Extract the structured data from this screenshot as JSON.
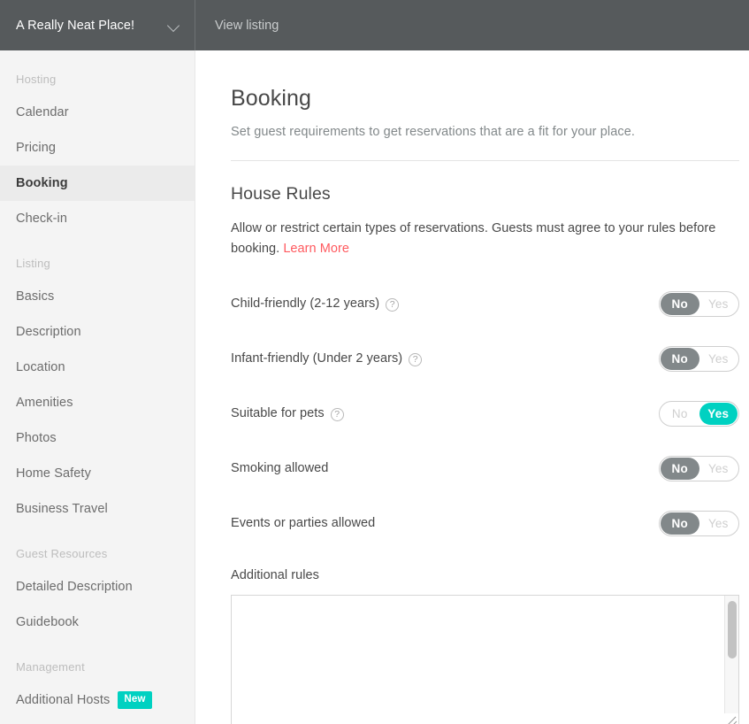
{
  "topbar": {
    "listing_name": "A Really Neat Place!",
    "dropdown_icon": "chevron-down-icon",
    "view_listing_label": "View listing"
  },
  "sidebar": {
    "groups": [
      {
        "title": "Hosting",
        "items": [
          {
            "label": "Calendar",
            "active": false
          },
          {
            "label": "Pricing",
            "active": false
          },
          {
            "label": "Booking",
            "active": true
          },
          {
            "label": "Check-in",
            "active": false
          }
        ]
      },
      {
        "title": "Listing",
        "items": [
          {
            "label": "Basics",
            "active": false
          },
          {
            "label": "Description",
            "active": false
          },
          {
            "label": "Location",
            "active": false
          },
          {
            "label": "Amenities",
            "active": false
          },
          {
            "label": "Photos",
            "active": false
          },
          {
            "label": "Home Safety",
            "active": false
          },
          {
            "label": "Business Travel",
            "active": false
          }
        ]
      },
      {
        "title": "Guest Resources",
        "items": [
          {
            "label": "Detailed Description",
            "active": false
          },
          {
            "label": "Guidebook",
            "active": false
          }
        ]
      },
      {
        "title": "Management",
        "items": [
          {
            "label": "Additional Hosts",
            "active": false,
            "badge": "New"
          }
        ]
      }
    ]
  },
  "main": {
    "title": "Booking",
    "subtitle": "Set guest requirements to get reservations that are a fit for your place.",
    "section": {
      "title": "House Rules",
      "description": "Allow or restrict certain types of reservations. Guests must agree to your rules before booking. ",
      "learn_more_label": "Learn More"
    },
    "toggle_options": {
      "no": "No",
      "yes": "Yes"
    },
    "rules": [
      {
        "label": "Child-friendly (2-12 years)",
        "help": true,
        "value": "No"
      },
      {
        "label": "Infant-friendly (Under 2 years)",
        "help": true,
        "value": "No"
      },
      {
        "label": "Suitable for pets",
        "help": true,
        "value": "Yes"
      },
      {
        "label": "Smoking allowed",
        "help": false,
        "value": "No"
      },
      {
        "label": "Events or parties allowed",
        "help": false,
        "value": "No"
      }
    ],
    "additional_rules": {
      "label": "Additional rules",
      "value": "",
      "placeholder": ""
    }
  },
  "colors": {
    "header_bg": "#565A5C",
    "sidebar_bg": "#F4F4F4",
    "active_nav_bg": "#EBEBEB",
    "accent_teal": "#00D1C1",
    "link_red": "#FF5A5F",
    "toggle_no_bg": "#82888A",
    "text_primary": "#484848",
    "text_muted": "#82888A"
  },
  "icons": {
    "help": "?",
    "chevron_down": "chevron-down-icon"
  }
}
